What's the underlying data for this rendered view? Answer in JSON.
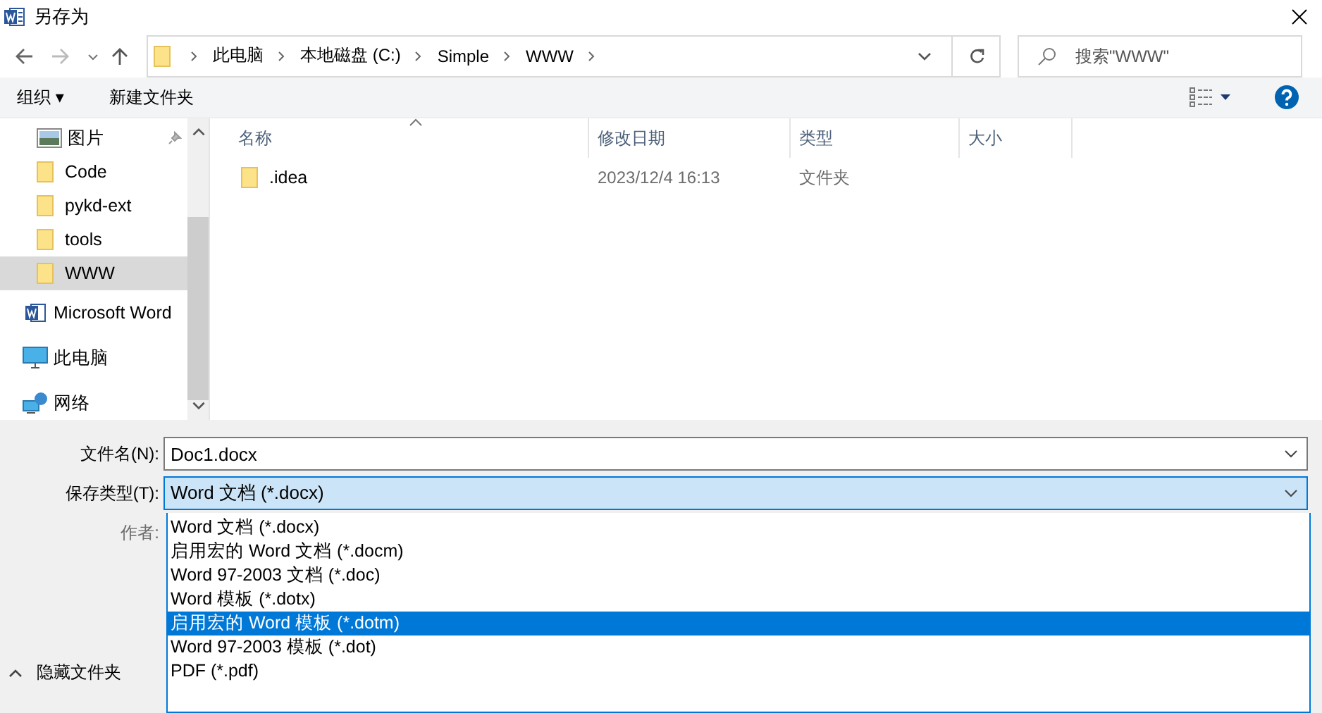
{
  "window": {
    "title": "另存为"
  },
  "address_bar": {
    "crumbs": [
      "此电脑",
      "本地磁盘 (C:)",
      "Simple",
      "WWW"
    ]
  },
  "search": {
    "placeholder": "搜索\"WWW\""
  },
  "toolbar": {
    "organize": "组织 ▾",
    "new_folder": "新建文件夹"
  },
  "sidebar": {
    "quick_access_items": [
      {
        "label": "图片",
        "kind": "pictures",
        "pinned": true,
        "selected": false
      },
      {
        "label": "Code",
        "kind": "folder",
        "pinned": false,
        "selected": false
      },
      {
        "label": "pykd-ext",
        "kind": "folder",
        "pinned": false,
        "selected": false
      },
      {
        "label": "tools",
        "kind": "folder",
        "pinned": false,
        "selected": false
      },
      {
        "label": "WWW",
        "kind": "folder",
        "pinned": false,
        "selected": true
      }
    ],
    "items": [
      {
        "label": "Microsoft Word",
        "kind": "word",
        "selected": false
      },
      {
        "label": "此电脑",
        "kind": "pc",
        "selected": false
      },
      {
        "label": "网络",
        "kind": "network",
        "selected": false
      }
    ]
  },
  "table": {
    "columns": [
      "名称",
      "修改日期",
      "类型",
      "大小"
    ],
    "rows": [
      {
        "name": ".idea",
        "modified": "2023/12/4 16:13",
        "type": "文件夹"
      }
    ]
  },
  "form": {
    "file_name_label": "文件名(N):",
    "file_name": "Doc1.docx",
    "file_type_label": "保存类型(T):",
    "file_type": "Word 文档 (*.docx)",
    "author_label": "作者:",
    "file_type_options": [
      {
        "label": "Word 文档 (*.docx)",
        "selected": false
      },
      {
        "label": "启用宏的 Word 文档 (*.docm)",
        "selected": false
      },
      {
        "label": "Word 97-2003 文档 (*.doc)",
        "selected": false
      },
      {
        "label": "Word 模板 (*.dotx)",
        "selected": false
      },
      {
        "label": "启用宏的 Word 模板 (*.dotm)",
        "selected": true
      },
      {
        "label": "Word 97-2003 模板 (*.dot)",
        "selected": false
      },
      {
        "label": "PDF (*.pdf)",
        "selected": false
      }
    ]
  },
  "hide_folders": "隐藏文件夹"
}
